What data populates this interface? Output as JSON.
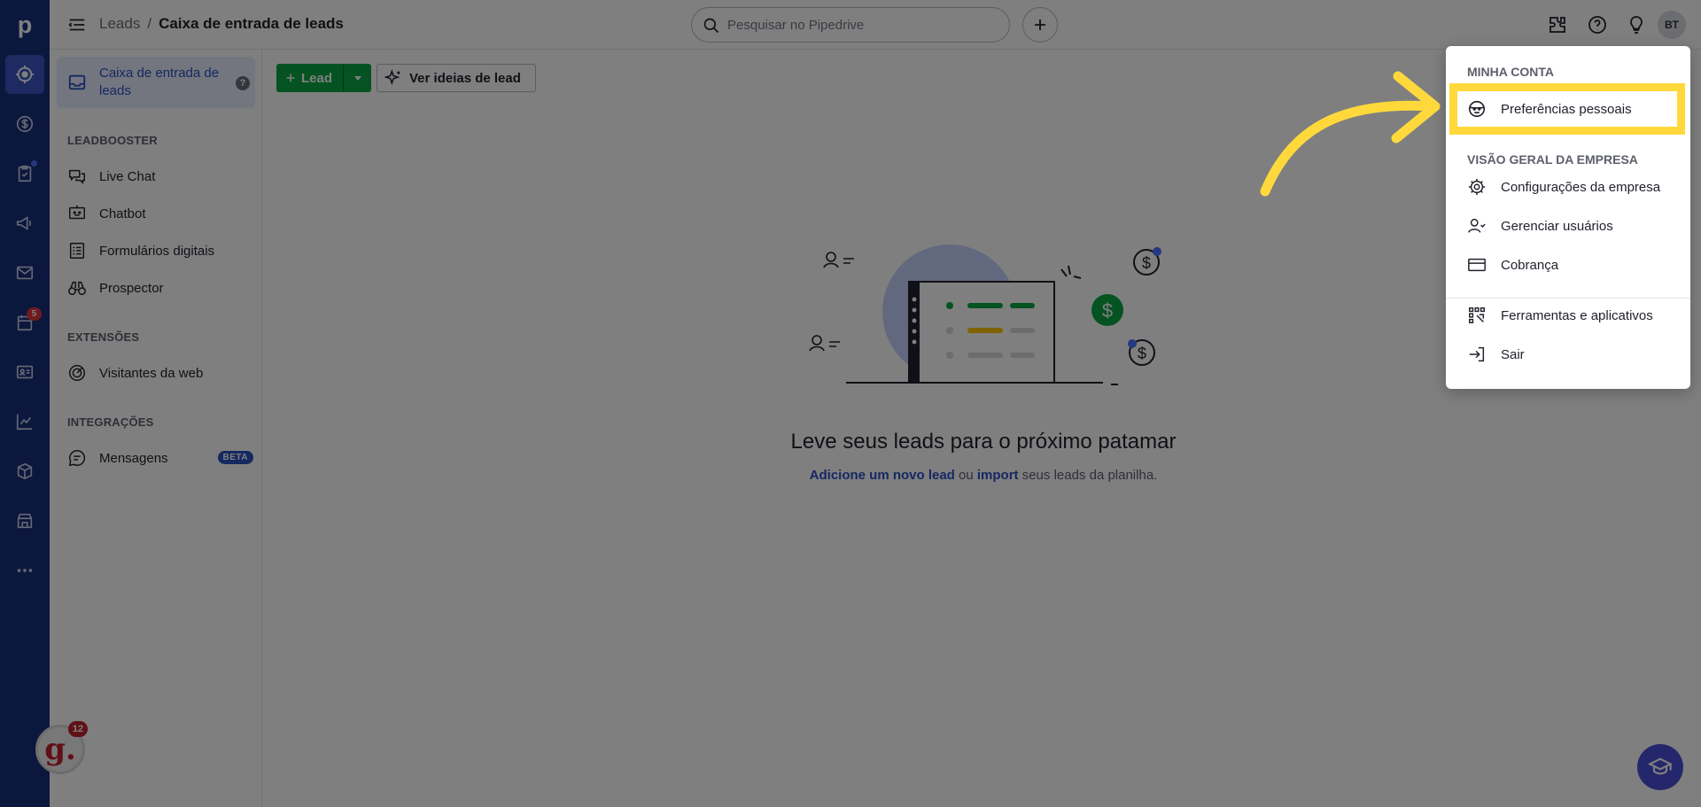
{
  "rail": {
    "notifications_badge": "5"
  },
  "header": {
    "breadcrumb_parent": "Leads",
    "breadcrumb_separator": "/",
    "breadcrumb_current": "Caixa de entrada de leads",
    "search_placeholder": "Pesquisar no Pipedrive",
    "avatar_initials": "BT"
  },
  "sidebar": {
    "active_item": "Caixa de entrada de leads",
    "help": "?",
    "sections": {
      "leadbooster": "LEADBOOSTER",
      "extensions": "EXTENSÕES",
      "integrations": "INTEGRAÇÕES"
    },
    "items": {
      "live_chat": "Live Chat",
      "chatbot": "Chatbot",
      "forms": "Formulários digitais",
      "prospector": "Prospector",
      "web_visitors": "Visitantes da web",
      "messages": "Mensagens",
      "beta": "BETA"
    }
  },
  "main": {
    "lead_button": "Lead",
    "ideas_button": "Ver ideias de lead",
    "empty_title": "Leve seus leads para o próximo patamar",
    "empty_link_add": "Adicione um novo lead",
    "empty_or": "ou",
    "empty_link_import": "import",
    "empty_suffix": "seus leads da planilha."
  },
  "dropdown": {
    "section_account": "MINHA CONTA",
    "personal_prefs": "Preferências pessoais",
    "section_company": "VISÃO GERAL DA EMPRESA",
    "company_settings": "Configurações da empresa",
    "manage_users": "Gerenciar usuários",
    "billing": "Cobrança",
    "tools_apps": "Ferramentas e aplicativos",
    "logout": "Sair"
  },
  "widgets": {
    "g_letter": "g.",
    "g_count": "12"
  }
}
